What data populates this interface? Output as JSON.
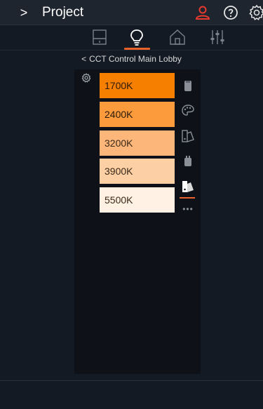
{
  "header": {
    "title": "Project",
    "chevron": ">",
    "icons": [
      "user-icon",
      "help-icon",
      "settings-icon"
    ],
    "user_icon_color": "#e63a2f"
  },
  "tabs": {
    "items": [
      "device-tab",
      "light-tab",
      "home-tab",
      "mixer-tab"
    ],
    "active": "light-tab",
    "accent": "#e8622a"
  },
  "breadcrumb": {
    "back": "<",
    "label": "CCT Control Main Lobby"
  },
  "presets": [
    {
      "label": "1700K",
      "color": "#f77f00",
      "text_color": "#2b1a0a"
    },
    {
      "label": "2400K",
      "color": "#fb9b3c",
      "text_color": "#2b1a0a"
    },
    {
      "label": "3200K",
      "color": "#fdb679",
      "text_color": "#3a2818"
    },
    {
      "label": "3900K",
      "color": "#fdcfa4",
      "text_color": "#3a2818"
    },
    {
      "label": "5500K",
      "color": "#fff1e4",
      "text_color": "#3a2818"
    }
  ],
  "side_icons": [
    "device-icon",
    "palette-icon",
    "scene-icon",
    "plug-icon",
    "scene-active-icon"
  ],
  "more": "•••"
}
